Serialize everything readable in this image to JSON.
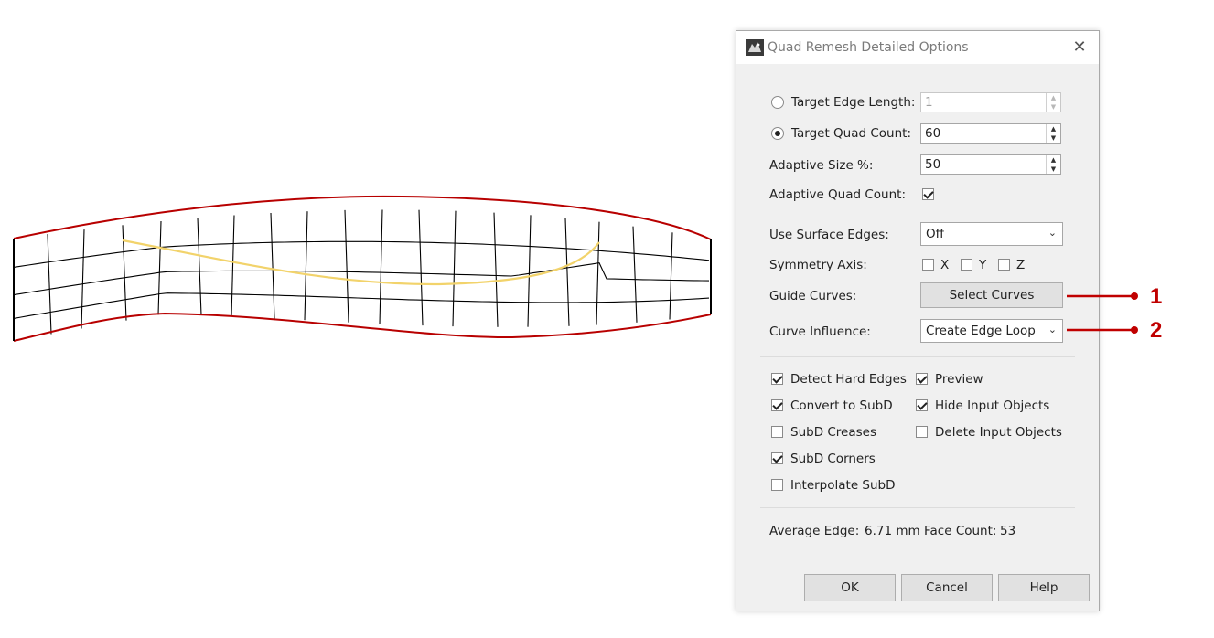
{
  "dialog": {
    "title": "Quad Remesh Detailed Options",
    "target_edge_length": {
      "label": "Target Edge Length:",
      "value": "1",
      "selected": false
    },
    "target_quad_count": {
      "label": "Target Quad Count:",
      "value": "60",
      "selected": true
    },
    "adaptive_size": {
      "label": "Adaptive Size %:",
      "value": "50"
    },
    "adaptive_quad_count": {
      "label": "Adaptive Quad Count:",
      "checked": true
    },
    "use_surface_edges": {
      "label": "Use Surface Edges:",
      "value": "Off"
    },
    "symmetry_axis": {
      "label": "Symmetry Axis:",
      "x": "X",
      "y": "Y",
      "z": "Z"
    },
    "guide_curves": {
      "label": "Guide Curves:",
      "button": "Select Curves"
    },
    "curve_influence": {
      "label": "Curve Influence:",
      "value": "Create Edge Loop"
    },
    "options": {
      "detect_hard_edges": "Detect Hard Edges",
      "convert_to_subd": "Convert to SubD",
      "subd_creases": "SubD Creases",
      "subd_corners": "SubD Corners",
      "interpolate_subd": "Interpolate SubD",
      "preview": "Preview",
      "hide_input_objects": "Hide Input Objects",
      "delete_input_objects": "Delete Input Objects"
    },
    "stats": {
      "average_edge_label": "Average Edge:",
      "average_edge_value": "6.71 mm",
      "face_count_label": "Face Count:",
      "face_count_value": "53"
    },
    "buttons": {
      "ok": "OK",
      "cancel": "Cancel",
      "help": "Help"
    }
  },
  "callouts": [
    "1",
    "2"
  ],
  "colors": {
    "boundary": "#b80000",
    "mesh": "#000000",
    "guide_curve": "#f2d36b",
    "callout": "#c00000"
  }
}
